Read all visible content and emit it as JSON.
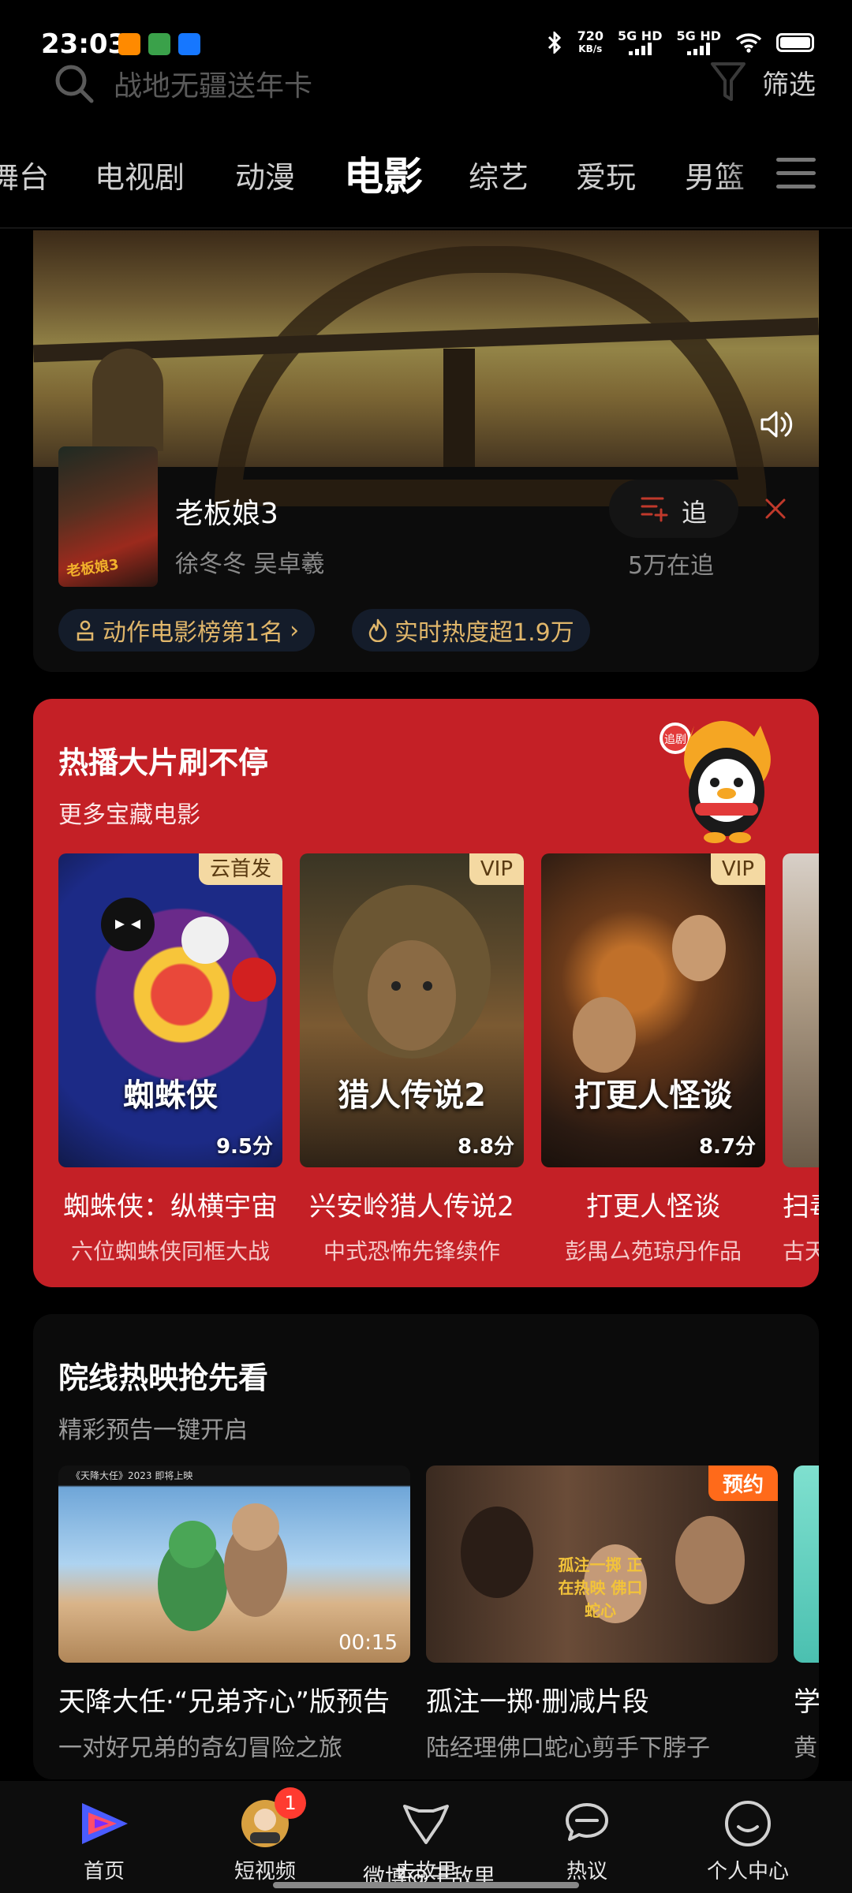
{
  "status_bar": {
    "time": "23:03",
    "net_speed": "720",
    "net_unit": "KB/s",
    "sim1": "5G HD",
    "sim2": "5G HD",
    "icons": [
      "bluetooth-icon",
      "wifi-icon",
      "battery-icon"
    ]
  },
  "search": {
    "placeholder": "战地无疆送年卡",
    "filter_label": "筛选"
  },
  "tabs": [
    "舞台",
    "电视剧",
    "动漫",
    "电影",
    "综艺",
    "爱玩",
    "男篮"
  ],
  "active_tab": "电影",
  "featured": {
    "title": "老板娘3",
    "poster_text": "老板娘3",
    "cast": "徐冬冬   吴卓羲",
    "follow_label": "追",
    "follow_count": "5万在追",
    "badges": [
      "动作电影榜第1名",
      "实时热度超1.9万"
    ]
  },
  "hot_section": {
    "title": "热播大片刷不停",
    "subtitle": "更多宝藏电影",
    "mascot_badge": "追剧",
    "movies": [
      {
        "tag": "云首发",
        "poster_text": "蜘蛛侠",
        "score": "9.5分",
        "name": "蜘蛛侠：纵横宇宙",
        "desc": "六位蜘蛛侠同框大战"
      },
      {
        "tag": "VIP",
        "poster_text": "猎人传说2",
        "score": "8.8分",
        "name": "兴安岭猎人传说2",
        "desc": "中式恐怖先锋续作"
      },
      {
        "tag": "VIP",
        "poster_text": "打更人怪谈",
        "score": "8.7分",
        "name": "打更人怪谈",
        "desc": "彭禺厶苑琼丹作品"
      },
      {
        "tag": "",
        "poster_text": "",
        "score": "",
        "name": "扫毒",
        "desc": "古天乐"
      }
    ]
  },
  "theater_section": {
    "title": "院线热映抢先看",
    "subtitle": "精彩预告一键开启",
    "trailers": [
      {
        "name": "天降大任·“兄弟齐心”版预告",
        "desc": "一对好兄弟的奇幻冒险之旅",
        "duration": "00:15",
        "badge": "",
        "thumb_caption": "《天降大任》2023 即将上映"
      },
      {
        "name": "孤注一掷·删减片段",
        "desc": "陆经理佛口蛇心剪手下脖子",
        "duration": "",
        "badge": "预约",
        "thumb_caption": "孤注一掷 正在热映 佛口蛇心"
      },
      {
        "name": "学",
        "desc": "黄",
        "duration": "",
        "badge": "",
        "thumb_caption": ""
      }
    ]
  },
  "bottom_nav": [
    {
      "label": "首页",
      "icon": "home-play-icon",
      "badge": ""
    },
    {
      "label": "短视频",
      "icon": "short-video-icon",
      "badge": "1"
    },
    {
      "label": "去故里",
      "icon": "explore-icon",
      "badge": ""
    },
    {
      "label": "热议",
      "icon": "discuss-icon",
      "badge": ""
    },
    {
      "label": "个人中心",
      "icon": "profile-icon",
      "badge": ""
    }
  ],
  "watermark": "微博@王敌里",
  "colors": {
    "background": "#000000",
    "hot_red": "#c42026",
    "vip_tag": "#f4d9a2",
    "preorder": "#ff6a1a",
    "nav_badge": "#ff3b30"
  }
}
